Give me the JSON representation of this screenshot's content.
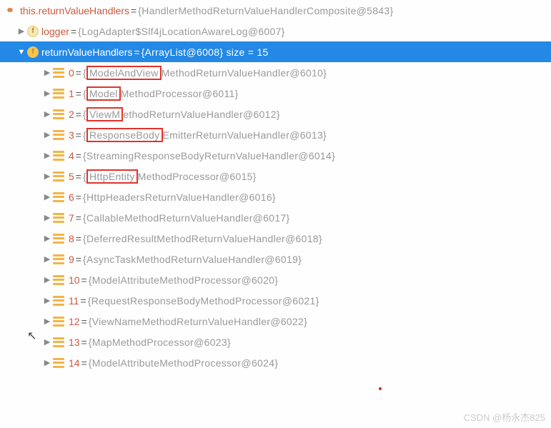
{
  "line0": {
    "name": "this.returnValueHandlers",
    "value": "{HandlerMethodReturnValueHandlerComposite@5843}"
  },
  "line1": {
    "name": "logger",
    "value": "{LogAdapter$Slf4jLocationAwareLog@6007}"
  },
  "line2": {
    "name": "returnValueHandlers",
    "value": "{ArrayList@6008}  size = 15"
  },
  "items": [
    {
      "idx": "0",
      "pre": "{",
      "hl": "ModelAndView",
      "post": "MethodReturnValueHandler@6010}"
    },
    {
      "idx": "1",
      "pre": "{",
      "hl": "Model",
      "post": "MethodProcessor@6011}"
    },
    {
      "idx": "2",
      "pre": "{",
      "hl": "ViewM",
      "post": "ethodReturnValueHandler@6012}"
    },
    {
      "idx": "3",
      "pre": "{",
      "hl": "ResponseBody",
      "post": "EmitterReturnValueHandler@6013}"
    },
    {
      "idx": "4",
      "pre": "",
      "hl": "",
      "post": "{StreamingResponseBodyReturnValueHandler@6014}"
    },
    {
      "idx": "5",
      "pre": "{",
      "hl": "HttpEntity",
      "post": "MethodProcessor@6015}"
    },
    {
      "idx": "6",
      "pre": "",
      "hl": "",
      "post": "{HttpHeadersReturnValueHandler@6016}"
    },
    {
      "idx": "7",
      "pre": "",
      "hl": "",
      "post": "{CallableMethodReturnValueHandler@6017}"
    },
    {
      "idx": "8",
      "pre": "",
      "hl": "",
      "post": "{DeferredResultMethodReturnValueHandler@6018}"
    },
    {
      "idx": "9",
      "pre": "",
      "hl": "",
      "post": "{AsyncTaskMethodReturnValueHandler@6019}"
    },
    {
      "idx": "10",
      "pre": "",
      "hl": "",
      "post": "{ModelAttributeMethodProcessor@6020}"
    },
    {
      "idx": "11",
      "pre": "",
      "hl": "",
      "post": "{RequestResponseBodyMethodProcessor@6021}"
    },
    {
      "idx": "12",
      "pre": "",
      "hl": "",
      "post": "{ViewNameMethodReturnValueHandler@6022}"
    },
    {
      "idx": "13",
      "pre": "",
      "hl": "",
      "post": "{MapMethodProcessor@6023}"
    },
    {
      "idx": "14",
      "pre": "",
      "hl": "",
      "post": "{ModelAttributeMethodProcessor@6024}"
    }
  ],
  "watermark": "CSDN @杨永杰825"
}
